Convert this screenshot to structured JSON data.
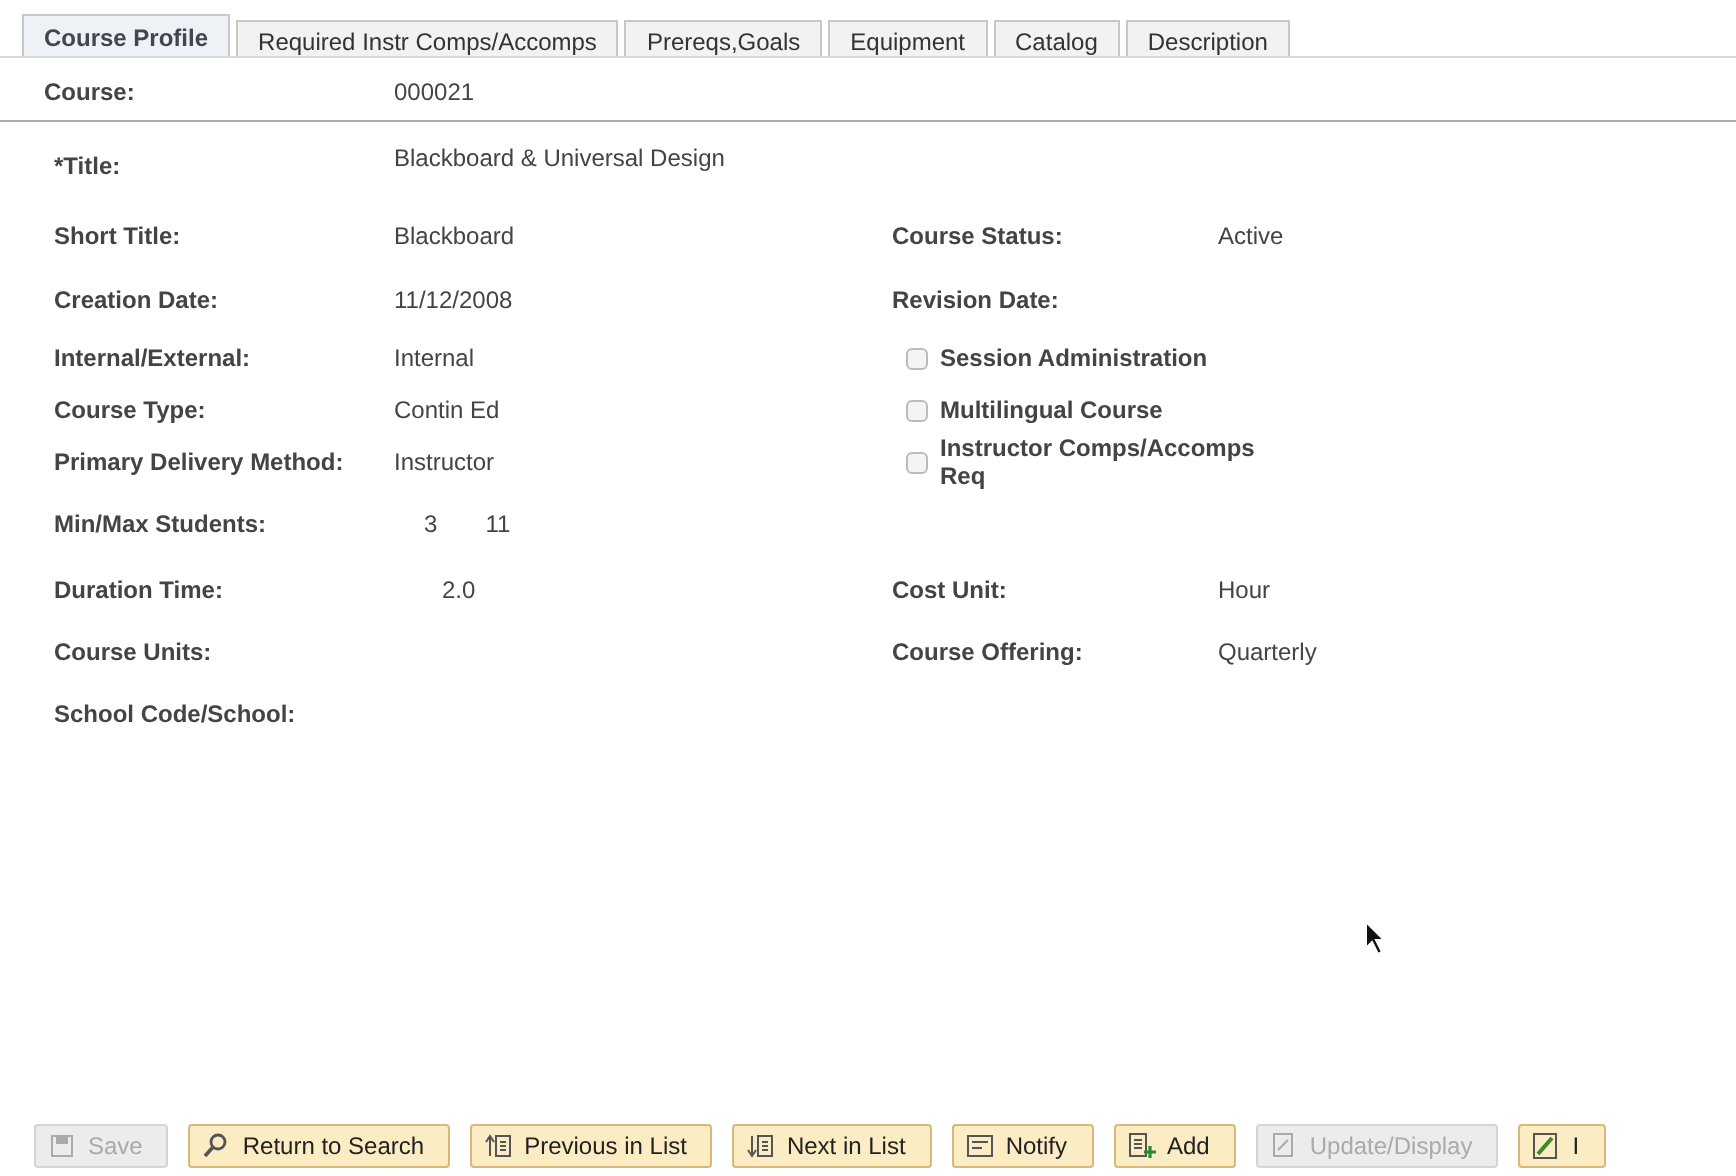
{
  "tabs": [
    {
      "label": "Course Profile",
      "selected": true
    },
    {
      "label": "Required Instr Comps/Accomps",
      "selected": false
    },
    {
      "label": "Prereqs,Goals",
      "selected": false
    },
    {
      "label": "Equipment",
      "selected": false
    },
    {
      "label": "Catalog",
      "selected": false
    },
    {
      "label": "Description",
      "selected": false
    }
  ],
  "course": {
    "label": "Course:",
    "value": "000021"
  },
  "rows": [
    {
      "left": {
        "label": "*Title:",
        "values": [
          "Blackboard & Universal Design"
        ]
      }
    },
    {
      "left": {
        "label": "Short Title:",
        "values": [
          "Blackboard"
        ]
      },
      "right": {
        "kind": "field",
        "label": "Course Status:",
        "value": "Active"
      }
    },
    {
      "left": {
        "label": "Creation Date:",
        "values": [
          "11/12/2008"
        ]
      },
      "right": {
        "kind": "field",
        "label": "Revision Date:"
      }
    },
    {
      "left": {
        "label": "Internal/External:",
        "values": [
          "Internal"
        ]
      },
      "right": {
        "kind": "checkbox",
        "label": "Session Administration",
        "checked": false
      }
    },
    {
      "left": {
        "label": "Course Type:",
        "values": [
          "Contin Ed"
        ]
      },
      "right": {
        "kind": "checkbox",
        "label": "Multilingual Course",
        "checked": false
      }
    },
    {
      "left": {
        "label": "Primary Delivery Method:",
        "values": [
          "Instructor"
        ]
      },
      "right": {
        "kind": "checkbox",
        "label": "Instructor Comps/Accomps Req",
        "checked": false
      }
    },
    {
      "left": {
        "label": "Min/Max Students:",
        "values": [
          "3",
          "11"
        ]
      }
    },
    {
      "left": {
        "label": "Duration Time:",
        "values": [
          "2.0"
        ]
      },
      "right": {
        "kind": "field",
        "label": "Cost Unit:",
        "value": "Hour"
      }
    },
    {
      "left": {
        "label": "Course Units:"
      },
      "right": {
        "kind": "field",
        "label": "Course Offering:",
        "value": "Quarterly"
      }
    },
    {
      "left": {
        "label": "School Code/School:"
      }
    }
  ],
  "buttons": [
    {
      "label": "Save",
      "disabled": true
    },
    {
      "label": "Return to Search",
      "disabled": false
    },
    {
      "label": "Previous in List",
      "disabled": false
    },
    {
      "label": "Next in List",
      "disabled": false
    },
    {
      "label": "Notify",
      "disabled": false
    },
    {
      "label": "Add",
      "disabled": false
    },
    {
      "label": "Update/Display",
      "disabled": true
    },
    {
      "label": "I",
      "disabled": false
    }
  ]
}
